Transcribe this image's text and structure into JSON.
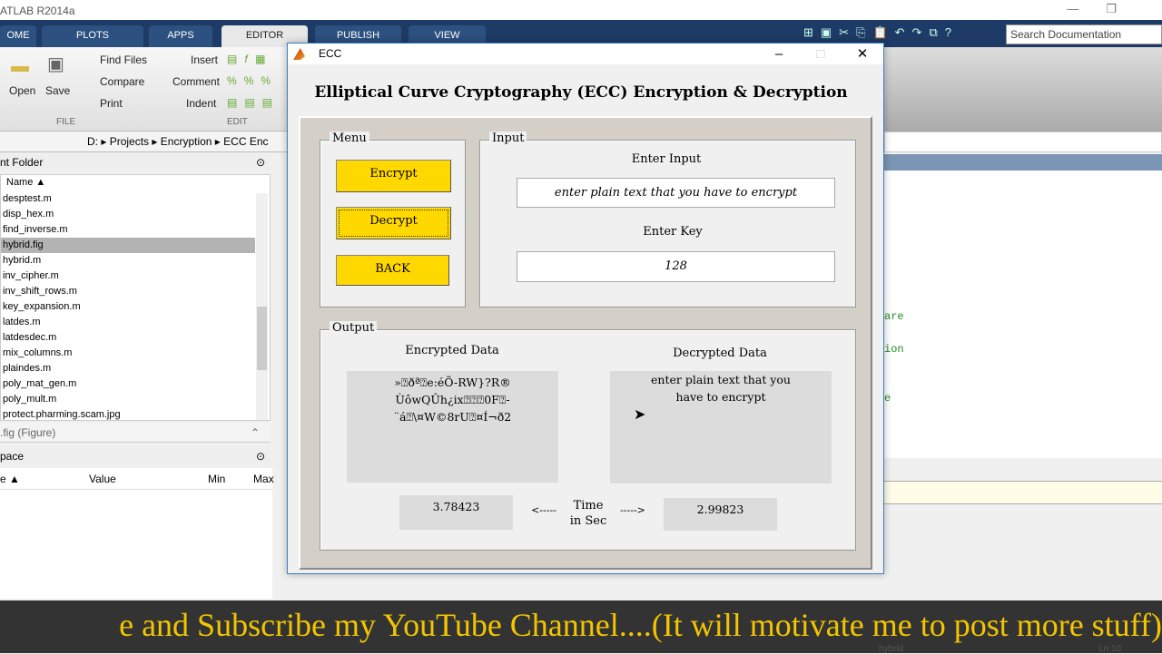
{
  "app": {
    "title": "ATLAB R2014a",
    "search_placeholder": "Search Documentation"
  },
  "tabs": [
    "OME",
    "PLOTS",
    "APPS",
    "EDITOR",
    "PUBLISH",
    "VIEW"
  ],
  "ribbon": {
    "open": "Open",
    "save": "Save",
    "find_files": "Find Files",
    "compare": "Compare",
    "print": "Print",
    "insert": "Insert",
    "comment": "Comment",
    "indent": "Indent",
    "file_section": "FILE",
    "edit_section": "EDIT"
  },
  "address": {
    "segments": [
      "D:",
      "Projects",
      "Encryption",
      "ECC Enc"
    ]
  },
  "folder": {
    "header": "nt Folder",
    "name_col": "Name ▲",
    "files": [
      "desptest.m",
      "disp_hex.m",
      "find_inverse.m",
      "hybrid.fig",
      "hybrid.m",
      "inv_cipher.m",
      "inv_shift_rows.m",
      "key_expansion.m",
      "latdes.m",
      "latdesdec.m",
      "mix_columns.m",
      "plaindes.m",
      "poly_mat_gen.m",
      "poly_mult.m",
      "protect.pharming.scam.jpg"
    ],
    "selected_index": 3,
    "details": ".fig (Figure)"
  },
  "workspace": {
    "header": "pace",
    "columns": [
      "e ▲",
      "Value",
      "Min",
      "Max"
    ]
  },
  "editor": {
    "code_fragments": [
      "are",
      "ion",
      "e"
    ]
  },
  "status": {
    "file": "hybrid",
    "ln": "Ln  10"
  },
  "ecc": {
    "window_title": "ECC",
    "headline": "Elliptical Curve Cryptography (ECC) Encryption & Decryption",
    "menu": {
      "label": "Menu",
      "encrypt": "Encrypt",
      "decrypt": "Decrypt",
      "back": "BACK"
    },
    "input": {
      "label": "Input",
      "enter_input": "Enter Input",
      "input_value": "enter plain text that you have to encrypt",
      "enter_key": "Enter Key",
      "key_value": "128"
    },
    "output": {
      "label": "Output",
      "encrypted_label": "Encrypted Data",
      "encrypted_lines": [
        "»⍰ðª⍰e:éÕ-RW}?R®",
        "ÙôwQÛh¿ix⍰⍰⍰0F⍰-",
        "¨á⍰\\¤W©8rU⍰¤Í¬ð2"
      ],
      "decrypted_label": "Decrypted Data",
      "decrypted_text": "enter plain text that you have to encrypt",
      "enc_time": "3.78423",
      "dec_time": "2.99823",
      "arrow_left": "<-----",
      "arrow_right": "----->",
      "time_label_1": "Time",
      "time_label_2": "in Sec"
    }
  },
  "banner": "e and Subscribe my YouTube Channel....(It will motivate me to post more stuff)",
  "colors": {
    "button_yellow": "#ffd800",
    "panel": "#d4d0c8",
    "tabstrip": "#1d3b66",
    "banner_text": "#f2c500"
  }
}
